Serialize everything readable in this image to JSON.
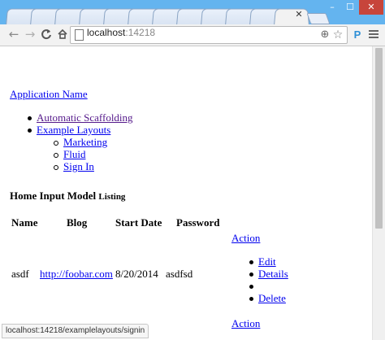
{
  "browser": {
    "accent_color": "#64b4ef",
    "tab_close_icon": "close-icon",
    "window_buttons": {
      "minimize": "–",
      "maximize": "☐",
      "close": "✕"
    },
    "nav": {
      "back": "←",
      "forward": "→",
      "reload": "C",
      "home": "⌂"
    },
    "address": {
      "host": "localhost",
      "port": ":14218"
    },
    "icons": {
      "zoom": "⊕",
      "bookmark_star": "☆",
      "extension": "P",
      "menu": "menu-icon"
    },
    "status_url": "localhost:14218/examplelayouts/signin"
  },
  "page": {
    "brand": "Application Name",
    "nav": {
      "automatic_scaffolding": "Automatic Scaffolding",
      "example_layouts": "Example Layouts",
      "sub": {
        "marketing": "Marketing",
        "fluid": "Fluid",
        "sign_in": "Sign In"
      }
    },
    "heading": {
      "main": "Home Input Model",
      "small": "Listing"
    },
    "table": {
      "headers": [
        "Name",
        "Blog",
        "Start Date",
        "Password"
      ],
      "action_label": "Action",
      "rows": [
        {
          "name": "asdf",
          "blog": "http://foobar.com",
          "start_date": "8/20/2014",
          "password": "asdfsd",
          "actions": [
            "Edit",
            "Details",
            "",
            "Delete"
          ]
        }
      ],
      "footer_action_label": "Action"
    }
  }
}
